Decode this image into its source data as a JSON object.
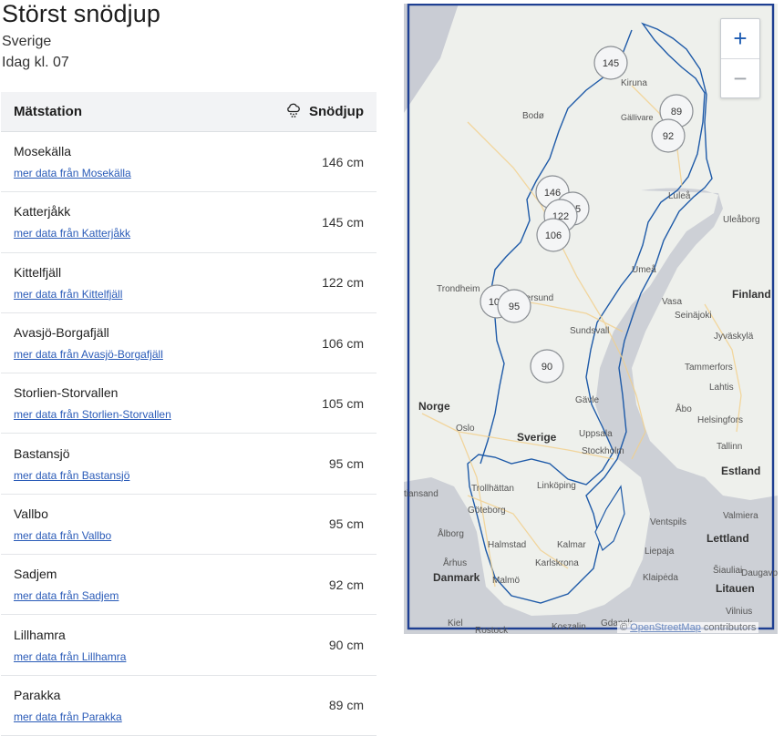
{
  "header": {
    "title": "Störst snödjup",
    "region": "Sverige",
    "time": "Idag kl. 07"
  },
  "table": {
    "col_station": "Mätstation",
    "col_depth": "Snödjup",
    "rows": [
      {
        "name": "Mosekälla",
        "link": "mer data från Mosekälla",
        "value": "146 cm"
      },
      {
        "name": "Katterjåkk",
        "link": "mer data från Katterjåkk",
        "value": "145 cm"
      },
      {
        "name": "Kittelfjäll",
        "link": "mer data från Kittelfjäll",
        "value": "122 cm"
      },
      {
        "name": "Avasjö-Borgafjäll",
        "link": "mer data från Avasjö-Borgafjäll",
        "value": "106 cm"
      },
      {
        "name": "Storlien-Storvallen",
        "link": "mer data från Storlien-Storvallen",
        "value": "105 cm"
      },
      {
        "name": "Bastansjö",
        "link": "mer data från Bastansjö",
        "value": "95 cm"
      },
      {
        "name": "Vallbo",
        "link": "mer data från Vallbo",
        "value": "95 cm"
      },
      {
        "name": "Sadjem",
        "link": "mer data från Sadjem",
        "value": "92 cm"
      },
      {
        "name": "Lillhamra",
        "link": "mer data från Lillhamra",
        "value": "90 cm"
      },
      {
        "name": "Parakka",
        "link": "mer data från Parakka",
        "value": "89 cm"
      }
    ]
  },
  "map": {
    "markers": [
      "145",
      "89",
      "92",
      "146",
      "105",
      "122",
      "106",
      "105",
      "95",
      "90"
    ],
    "places": {
      "kiruna": "Kiruna",
      "gallivare": "Gällivare",
      "bodo": "Bodø",
      "lulea": "Luleå",
      "uleaborg": "Uleåborg",
      "umea": "Umeå",
      "trondheim": "Trondheim",
      "ostersund": "Östersund",
      "vasa": "Vasa",
      "seinajoki": "Seinäjoki",
      "jyvaskyla": "Jyväskylä",
      "finland": "Finland",
      "sundsvall": "Sundsvall",
      "tammerfors": "Tammerfors",
      "lahtis": "Lahtis",
      "abo": "Åbo",
      "helsingfors": "Helsingfors",
      "norge": "Norge",
      "gavle": "Gävle",
      "oslo": "Oslo",
      "sverige": "Sverige",
      "uppsala": "Uppsala",
      "stockholm": "Stockholm",
      "tallinn": "Tallinn",
      "estland": "Estland",
      "kristiansand": "tiansand",
      "trollhattan": "Trollhättan",
      "linkoping": "Linköping",
      "goteborg": "Göteborg",
      "ventspils": "Ventspils",
      "valmiera": "Valmiera",
      "alborg": "Ålborg",
      "halmstad": "Halmstad",
      "kalmar": "Kalmar",
      "lettland": "Lettland",
      "arhus": "Århus",
      "liepaja": "Liepaja",
      "karlskrona": "Karlskrona",
      "siauliai": "Šiauliai",
      "daugavpils": "Daugavpi",
      "danmark": "Danmark",
      "malmo": "Malmö",
      "klaipeda": "Klaipėda",
      "litauen": "Litauen",
      "vilnius": "Vilnius",
      "kiel": "Kiel",
      "rostock": "Rostock",
      "koszalin": "Koszalin",
      "gdansk": "Gdansk"
    },
    "zoom_in": "+",
    "zoom_out": "−",
    "attribution_prefix": "© ",
    "attribution_link": "OpenStreetMap",
    "attribution_suffix": " contributors"
  },
  "colors": {
    "accent": "#1f5db3",
    "link": "#2a5bb8",
    "border": "#1e3f92",
    "sea": "#c9ccd4",
    "land": "#eef0ec"
  },
  "icons": {
    "snow": "snow-cloud-icon"
  }
}
